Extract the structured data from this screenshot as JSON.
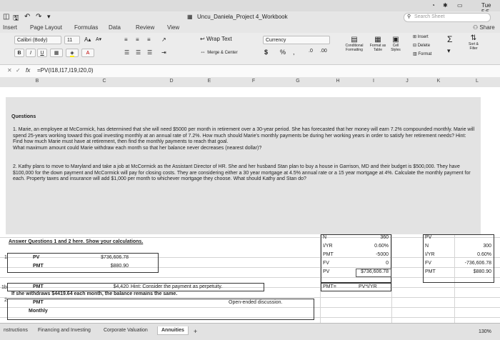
{
  "macbar": {
    "time": "Tue 5:5"
  },
  "window": {
    "title": "Uncu_Daniela_Project 4_Workbook"
  },
  "search": {
    "placeholder": "Search Sheet"
  },
  "ribbon_tabs": [
    "Insert",
    "Page Layout",
    "Formulas",
    "Data",
    "Review",
    "View"
  ],
  "share_label": "Share",
  "ribbon": {
    "font_name": "Calibri (Body)",
    "font_size": "11",
    "grow": "A▴",
    "shrink": "A▾",
    "bold": "B",
    "italic": "I",
    "underline": "U",
    "font_color": "A",
    "wrap_text": "Wrap Text",
    "merge_center": "Merge & Center",
    "number_format": "Currency",
    "dollar": "$",
    "percent": "%",
    "comma": ",",
    "conditional_formatting": "Conditional Formatting",
    "format_as_table": "Format as Table",
    "cell_styles": "Cell Styles",
    "insert": "Insert",
    "delete": "Delete",
    "format": "Format",
    "sort_filter": "Sort & Filter"
  },
  "formula_bar": {
    "fx": "fx",
    "formula": "=PV(I18,I17,I19,I20,0)"
  },
  "columns": [
    "B",
    "C",
    "D",
    "E",
    "F",
    "G",
    "H",
    "I",
    "J",
    "K",
    "L"
  ],
  "questions": {
    "heading": "Questions",
    "q1": "1. Marie, an employee at McCormick, has determined that she will need $5000 per month in retirement over a 30-year period. She has forecasted that her money will earn 7.2% compounded monthly. Marie will spend 25-years working toward this goal investing monthly at an annual rate of 7.2%. How much should Marie's monthly payments be during her working years in order to satisfy her retirement needs? Hint: Find how much Marie must have at retirement, then find the monthly payments to reach that goal.",
    "q1b": "What maximum amount could Marie withdraw each month so that her balance never decreases (nearest dollar)?",
    "q2": "2. Kathy plans to move to Maryland and take a job at McCormick as the Assistant Director of HR.  She and her husband Stan plan to buy a house in Garrison, MD and their budget is $500,000. They have $100,000 for the down payment and McCormick will pay for closing costs. They are considering either a 30 year mortgage at 4.5% annual rate or a 15 year mortgage at 4%. Calculate the monthly payment for each. Property taxes and insurance will add $1,000 per month to whichever mortgage they choose. What should Kathy and Stan do?"
  },
  "answer_heading": "Answer Questions 1 and 2 here. Show your calculations.",
  "rows": {
    "r1": "1",
    "r1b": "1b",
    "r2": "2"
  },
  "answers": {
    "pv_label": "PV",
    "pv_value": "$736,606.78",
    "pmt_label": "PMT",
    "pmt_value": "$880.90",
    "pmt1b_label": "PMT",
    "pmt1b_value": "$4,420",
    "pmt1b_hint": "Hint: Consider the payment as perpetuity.",
    "withdraw_note": "If she withdraws $4419.64 each month, the balance remains the same.",
    "q2_pmt": "PMT",
    "q2_monthly": "Monthly",
    "open_ended": "Open-ended discussion."
  },
  "calc_table_1": {
    "labels": [
      "N",
      "I/YR",
      "PMT",
      "FV",
      "PV"
    ],
    "values": [
      "360",
      "0.60%",
      "-5000",
      "0",
      "$736,606.78"
    ]
  },
  "calc_table_2": {
    "labels": [
      "PV",
      "N",
      "I/YR",
      "FV",
      "PMT"
    ],
    "values": [
      "",
      "300",
      "0.60%",
      "-736,606.78",
      "$880.90"
    ]
  },
  "perp": {
    "label": "PMT=",
    "formula": "PV*I/YR"
  },
  "sheet_tabs": [
    "nstructions",
    "Financing and Investing",
    "Corporate Valuation",
    "Annuities"
  ],
  "add_sheet": "+",
  "zoom": "130%"
}
